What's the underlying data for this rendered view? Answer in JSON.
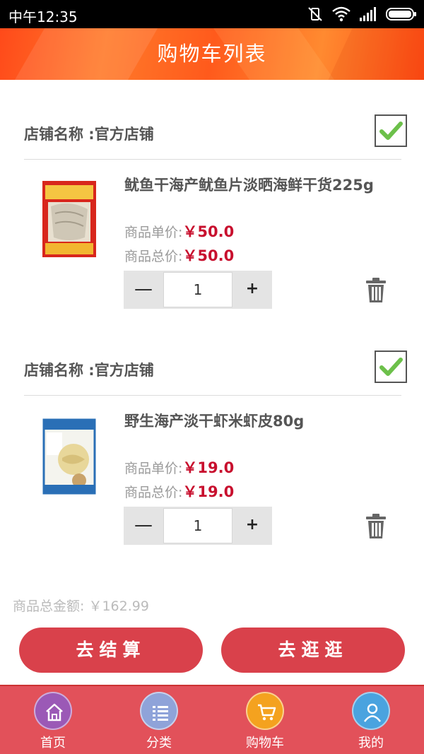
{
  "status_bar": {
    "time": "中午12:35"
  },
  "header": {
    "title": "购物车列表"
  },
  "shops": [
    {
      "shop_label": "店铺名称 :官方店铺",
      "checked": true,
      "product": {
        "name": "鱿鱼干海产鱿鱼片淡晒海鲜干货225g",
        "unit_price_label": "商品单价:",
        "unit_price": "￥50.0",
        "total_price_label": "商品总价:",
        "total_price": "￥50.0",
        "quantity": "1",
        "minus_label": "—",
        "plus_label": "+"
      }
    },
    {
      "shop_label": "店铺名称 :官方店铺",
      "checked": true,
      "product": {
        "name": "野生海产淡干虾米虾皮80g",
        "unit_price_label": "商品单价:",
        "unit_price": "￥19.0",
        "total_price_label": "商品总价:",
        "total_price": "￥19.0",
        "quantity": "1",
        "minus_label": "—",
        "plus_label": "+"
      }
    }
  ],
  "summary": {
    "total_label": "商品总金额: ￥162.99"
  },
  "actions": {
    "checkout": "去结算",
    "browse": "去逛逛"
  },
  "nav": [
    {
      "label": "首页",
      "icon": "home-icon",
      "color": "#9b59b6"
    },
    {
      "label": "分类",
      "icon": "list-icon",
      "color": "#8fa3d9"
    },
    {
      "label": "购物车",
      "icon": "cart-icon",
      "color": "#f4a21f"
    },
    {
      "label": "我的",
      "icon": "user-icon",
      "color": "#4aa3df"
    }
  ],
  "colors": {
    "accent": "#d9414b",
    "price": "#c8102e",
    "header": "#ff6a22"
  }
}
